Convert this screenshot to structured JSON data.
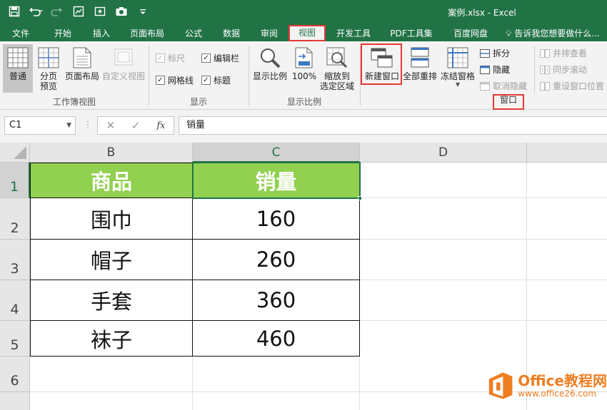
{
  "window": {
    "title": "案例.xlsx - Excel"
  },
  "tabs": [
    "文件",
    "开始",
    "插入",
    "页面布局",
    "公式",
    "数据",
    "审阅",
    "视图",
    "开发工具",
    "PDF工具集",
    "百度网盘"
  ],
  "active_tab": "视图",
  "tell_me": "告诉我您想要做什么...",
  "ribbon": {
    "workbook_views": {
      "label": "工作簿视图",
      "normal": "普通",
      "page_break_1": "分页",
      "page_break_2": "预览",
      "page_layout": "页面布局",
      "custom_views": "自定义视图"
    },
    "show": {
      "label": "显示",
      "ruler": "标尺",
      "formula_bar": "编辑栏",
      "gridlines": "网格线",
      "headings": "标题"
    },
    "zoom": {
      "label": "显示比例",
      "zoom": "显示比例",
      "hundred": "100%",
      "zoom_sel_1": "缩放到",
      "zoom_sel_2": "选定区域"
    },
    "window": {
      "label": "窗口",
      "new_window": "新建窗口",
      "arrange_all": "全部重排",
      "freeze_panes": "冻结窗格",
      "split": "拆分",
      "hide": "隐藏",
      "unhide": "取消隐藏",
      "side_by_side": "并排查看",
      "sync_scroll": "同步滚动",
      "reset_pos": "重设窗口位置"
    }
  },
  "formula_bar": {
    "name_box": "C1",
    "content": "销量"
  },
  "columns": [
    "B",
    "C",
    "D"
  ],
  "rows": [
    "1",
    "2",
    "3",
    "4",
    "5",
    "6"
  ],
  "table": {
    "headers": [
      "商品",
      "销量"
    ],
    "rows": [
      [
        "围巾",
        "160"
      ],
      [
        "帽子",
        "260"
      ],
      [
        "手套",
        "360"
      ],
      [
        "袜子",
        "460"
      ]
    ]
  },
  "watermark": {
    "title": "Office教程网",
    "url": "www.office26.com"
  },
  "colors": {
    "excel_green": "#217346",
    "header_fill": "#92d050",
    "highlight_red": "#e53935",
    "watermark_orange": "#ee7d21"
  }
}
